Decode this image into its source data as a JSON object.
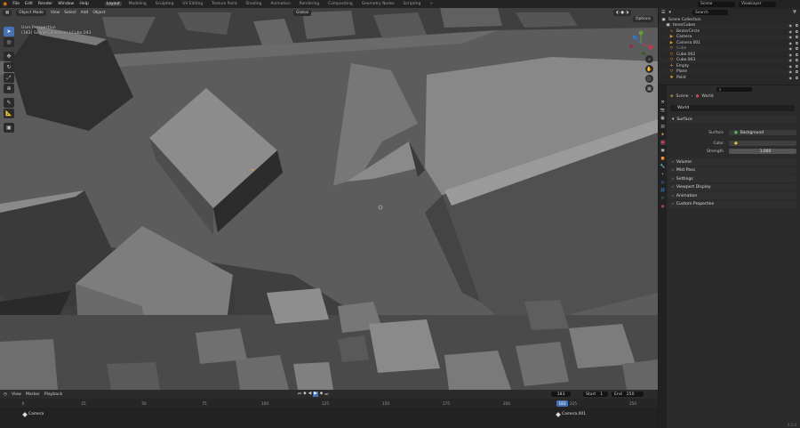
{
  "topbar": {
    "menus": [
      "File",
      "Edit",
      "Render",
      "Window",
      "Help"
    ],
    "workspaces": [
      "Layout",
      "Modeling",
      "Sculpting",
      "UV Editing",
      "Texture Paint",
      "Shading",
      "Animation",
      "Rendering",
      "Compositing",
      "Geometry Nodes",
      "Scripting"
    ],
    "active_workspace": "Layout",
    "scene": "Scene",
    "view_layer": "ViewLayer"
  },
  "viewport": {
    "mode": "Object Mode",
    "menus": [
      "View",
      "Select",
      "Add",
      "Object"
    ],
    "orientation": "Global",
    "options": "Options",
    "info_line1": "User Perspective",
    "info_line2": "(183) Scene Collection | Cube.043"
  },
  "timeline": {
    "menus": [
      "View",
      "Marker",
      "Playback"
    ],
    "current_frame": "183",
    "start_label": "Start",
    "start_value": "1",
    "end_label": "End",
    "end_value": "250",
    "ruler": [
      "0",
      "25",
      "50",
      "75",
      "100",
      "125",
      "150",
      "175",
      "200",
      "225",
      "250"
    ],
    "markers": [
      {
        "label": "Camera"
      },
      {
        "label": "Camera.001"
      }
    ],
    "playhead_label": "183"
  },
  "outliner": {
    "title": "Scene Collection",
    "search_placeholder": "Search",
    "items": [
      {
        "label": "tenorCubes"
      },
      {
        "label": "BezierCircle"
      },
      {
        "label": "Camera"
      },
      {
        "label": "Camera.001"
      },
      {
        "label": "Cube"
      },
      {
        "label": "Cube.002"
      },
      {
        "label": "Cube.003"
      },
      {
        "label": "Empty"
      },
      {
        "label": "Plane"
      },
      {
        "label": "Point"
      }
    ]
  },
  "properties": {
    "breadcrumb_scene": "Scene",
    "breadcrumb_world": "World",
    "world_name": "World",
    "surface_header": "Surface",
    "surface_label": "Surface",
    "surface_value": "Background",
    "color_label": "Color",
    "strength_label": "Strength",
    "strength_value": "1.000",
    "panels": [
      "Volume",
      "Mist Pass",
      "Settings",
      "Viewport Display",
      "Animation",
      "Custom Properties"
    ]
  },
  "status": {
    "version": "4.1.0"
  },
  "colors": {
    "accent": "#4772b3",
    "viewport_bg": "#3f3f3f",
    "panel_bg": "#2b2b2b"
  }
}
